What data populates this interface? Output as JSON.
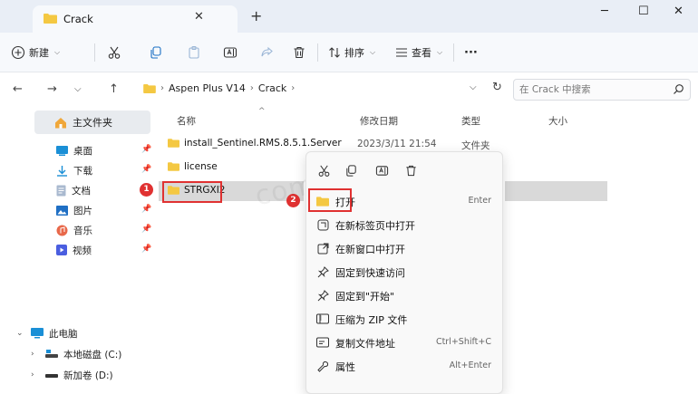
{
  "titlebar": {
    "tab_title": "Crack",
    "tab_close": "✕",
    "new_tab": "+",
    "minimize": "─",
    "maximize": "☐",
    "close": "✕"
  },
  "toolbar": {
    "new_label": "新建",
    "sort_label": "排序",
    "view_label": "查看",
    "more_label": "···"
  },
  "address": {
    "crumbs": [
      "Aspen Plus V14",
      "Crack"
    ],
    "search_placeholder": "在 Crack 中搜索"
  },
  "sidebar": {
    "home": "主文件夹",
    "quick_access": [
      {
        "label": "桌面",
        "icon": "desktop-icon",
        "color": "#1a8fd6"
      },
      {
        "label": "下载",
        "icon": "download-icon",
        "color": "#1a8fd6"
      },
      {
        "label": "文档",
        "icon": "document-icon",
        "color": "#7a8fa6"
      },
      {
        "label": "图片",
        "icon": "picture-icon",
        "color": "#1f6fc4"
      },
      {
        "label": "音乐",
        "icon": "music-icon",
        "color": "#e8684a"
      },
      {
        "label": "视频",
        "icon": "video-icon",
        "color": "#4a5ee0"
      }
    ],
    "tree": [
      {
        "label": "此电脑",
        "icon": "computer-icon"
      },
      {
        "label": "本地磁盘 (C:)",
        "icon": "drive-icon"
      },
      {
        "label": "新加卷 (D:)",
        "icon": "drive-icon"
      }
    ]
  },
  "filelist": {
    "columns": [
      "名称",
      "修改日期",
      "类型",
      "大小"
    ],
    "rows": [
      {
        "name": "install_Sentinel.RMS.8.5.1.Server",
        "date": "2023/3/11 21:54",
        "type": "文件夹"
      },
      {
        "name": "license",
        "date": "",
        "type": ""
      },
      {
        "name": "STRGXI2",
        "date": "",
        "type": ""
      }
    ]
  },
  "badges": [
    "1",
    "2"
  ],
  "context_menu": {
    "items": [
      {
        "label": "打开",
        "shortcut": "Enter",
        "icon": "folder-open-icon"
      },
      {
        "label": "在新标签页中打开",
        "shortcut": "",
        "icon": "new-tab-icon"
      },
      {
        "label": "在新窗口中打开",
        "shortcut": "",
        "icon": "new-window-icon"
      },
      {
        "label": "固定到快速访问",
        "shortcut": "",
        "icon": "pin-icon"
      },
      {
        "label": "固定到\"开始\"",
        "shortcut": "",
        "icon": "pin-start-icon"
      },
      {
        "label": "压缩为 ZIP 文件",
        "shortcut": "",
        "icon": "zip-icon"
      },
      {
        "label": "复制文件地址",
        "shortcut": "Ctrl+Shift+C",
        "icon": "copy-path-icon"
      },
      {
        "label": "属性",
        "shortcut": "Alt+Enter",
        "icon": "properties-icon"
      }
    ]
  },
  "watermark": "com       andrun",
  "colors": {
    "folder": "#f4c842",
    "highlight": "#e03131",
    "selection": "#d9d9d9"
  }
}
